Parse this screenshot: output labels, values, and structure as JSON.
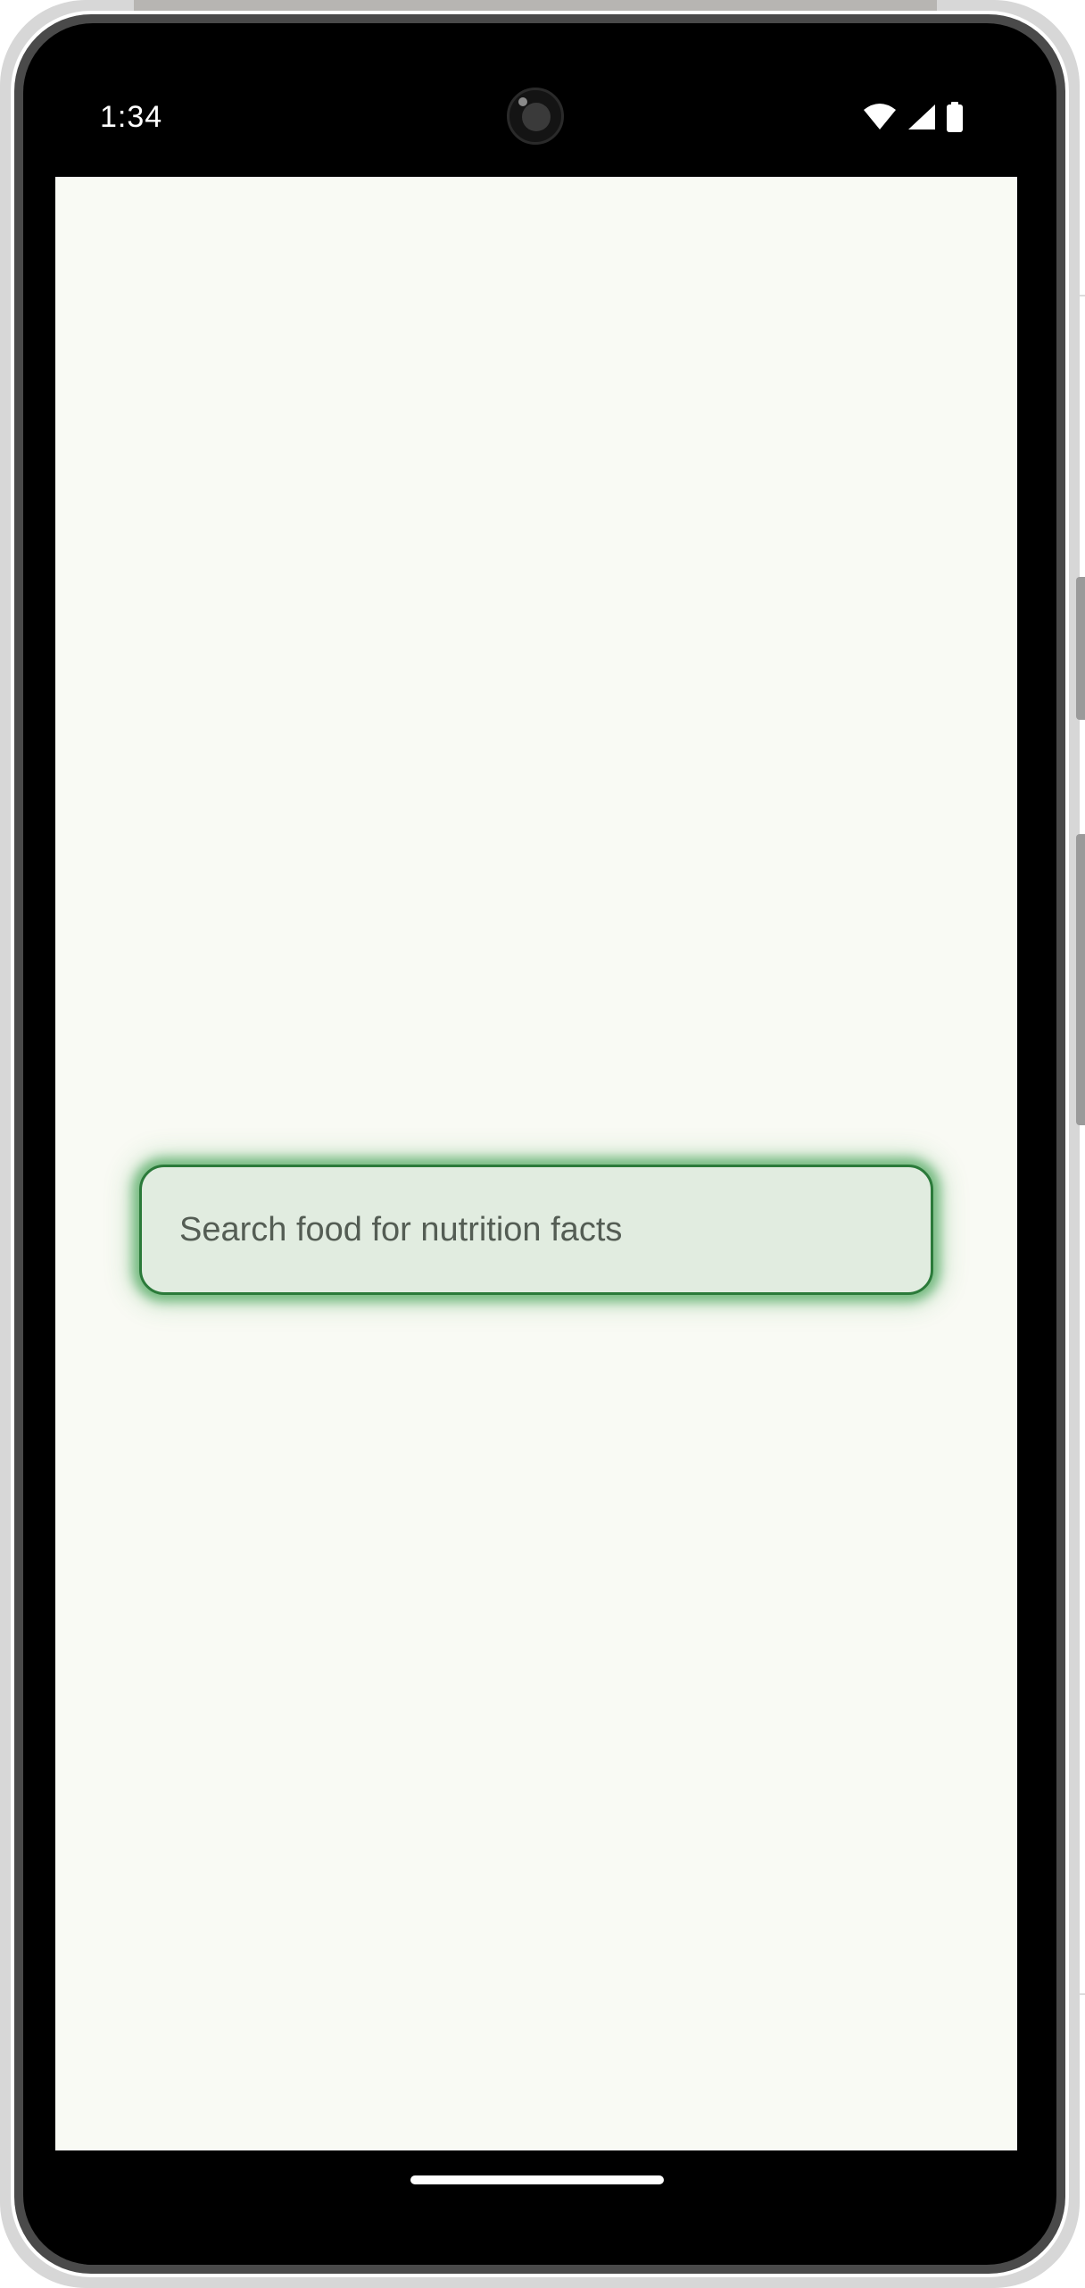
{
  "status_bar": {
    "time": "1:34",
    "icons": [
      "wifi-icon",
      "cellular-signal-icon",
      "battery-icon"
    ]
  },
  "search": {
    "placeholder": "Search food for nutrition facts"
  },
  "colors": {
    "app_background": "#f9faf4",
    "search_fill": "#e1ece0",
    "search_border": "#2b7a3a",
    "search_glow": "#28963c",
    "placeholder_text": "#545d54"
  }
}
